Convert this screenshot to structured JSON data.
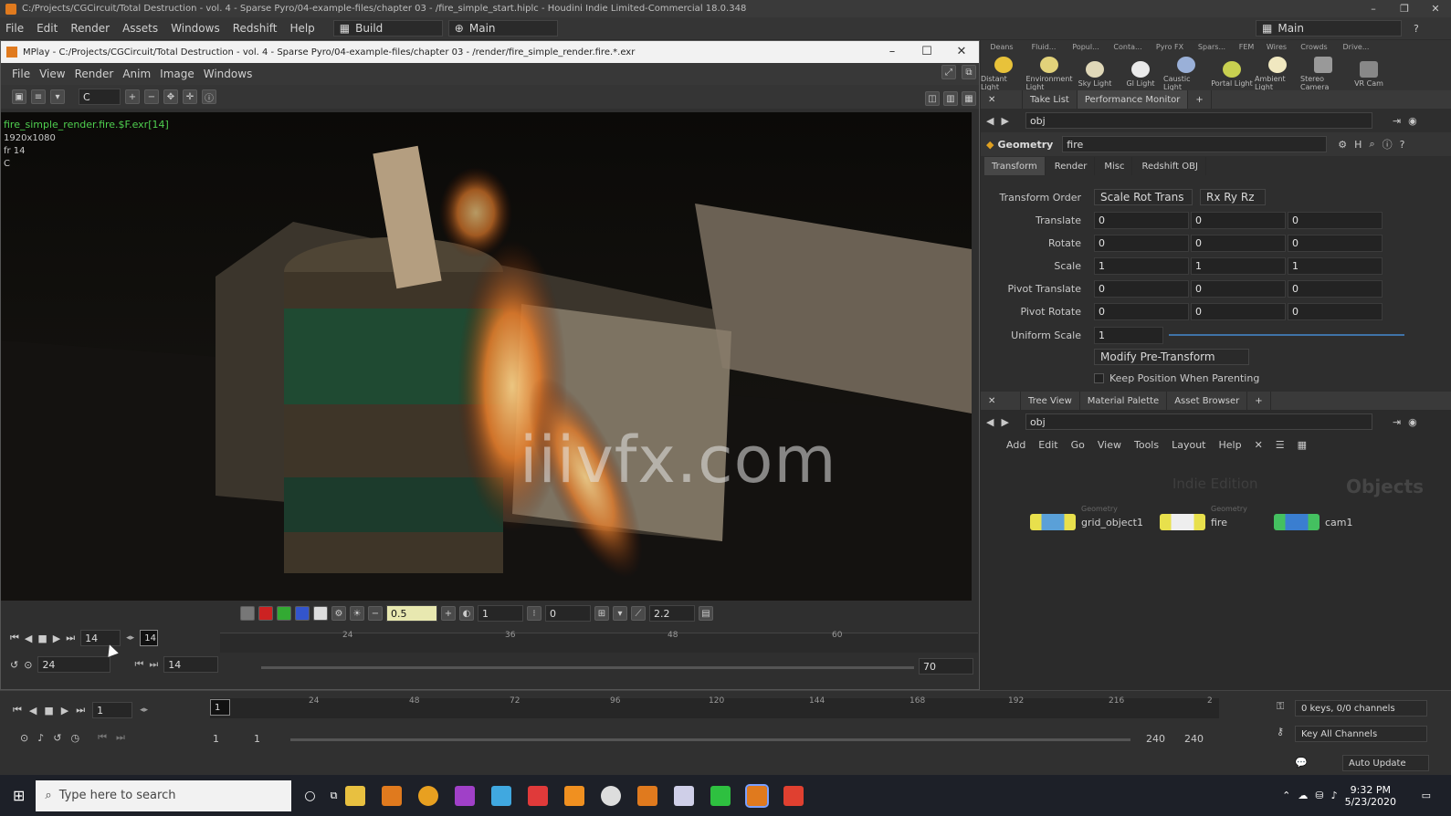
{
  "window": {
    "title": "C:/Projects/CGCircuit/Total Destruction - vol. 4 - Sparse Pyro/04-example-files/chapter 03 - /fire_simple_start.hiplc - Houdini Indie Limited-Commercial 18.0.348"
  },
  "menubar": {
    "items": [
      "File",
      "Edit",
      "Render",
      "Assets",
      "Windows",
      "Redshift",
      "Help"
    ],
    "desktop": "Build",
    "context": "Main",
    "right_desk": "Main"
  },
  "mplay": {
    "title": "MPlay - C:/Projects/CGCircuit/Total Destruction - vol. 4 - Sparse Pyro/04-example-files/chapter 03 - /render/fire_simple_render.fire.*.exr",
    "menu": [
      "File",
      "View",
      "Render",
      "Anim",
      "Image",
      "Windows"
    ],
    "channel": "C",
    "overlay": {
      "filename": "fire_simple_render.fire.$F.exr[14]",
      "res": "1920x1080",
      "frame": "fr 14",
      "channel": "C"
    },
    "watermark": "iiivfx.com",
    "controls": {
      "exposure": "0.5",
      "gamma_in": "1",
      "offset": "0",
      "gamma": "2.2"
    },
    "playbar": {
      "frame": "14",
      "frame_tag": "14",
      "fps": "24",
      "range_start": "14",
      "range_end": "70",
      "ticks": [
        "24",
        "36",
        "48",
        "60"
      ]
    }
  },
  "shelf": {
    "tabs": [
      "Deans",
      "Fluid...",
      "Popul...",
      "Conta...",
      "Pyro FX",
      "Spars...",
      "FEM",
      "Wires",
      "Crowds",
      "Drive..."
    ],
    "tools": [
      "Distant Light",
      "Environment Light",
      "Sky Light",
      "GI Light",
      "Caustic Light",
      "Portal Light",
      "Ambient Light",
      "Stereo Camera",
      "VR Cam"
    ]
  },
  "params": {
    "tabs_top": [
      "Take List",
      "Performance Monitor"
    ],
    "path": "obj",
    "node_type": "Geometry",
    "node_name": "fire",
    "tabs": [
      "Transform",
      "Render",
      "Misc",
      "Redshift OBJ"
    ],
    "transform_order_label": "Transform Order",
    "transform_order": "Scale Rot Trans",
    "rot_order": "Rx Ry Rz",
    "rows": [
      {
        "label": "Translate",
        "values": [
          "0",
          "0",
          "0"
        ]
      },
      {
        "label": "Rotate",
        "values": [
          "0",
          "0",
          "0"
        ]
      },
      {
        "label": "Scale",
        "values": [
          "1",
          "1",
          "1"
        ]
      },
      {
        "label": "Pivot Translate",
        "values": [
          "0",
          "0",
          "0"
        ]
      },
      {
        "label": "Pivot Rotate",
        "values": [
          "0",
          "0",
          "0"
        ]
      }
    ],
    "uniform_scale_label": "Uniform Scale",
    "uniform_scale": "1",
    "modify_pre": "Modify Pre-Transform",
    "keep_position": "Keep Position When Parenting"
  },
  "network": {
    "tabs": [
      "Tree View",
      "Material Palette",
      "Asset Browser"
    ],
    "path": "obj",
    "menu": [
      "Add",
      "Edit",
      "Go",
      "View",
      "Tools",
      "Layout",
      "Help"
    ],
    "bg_label": "Indie Edition",
    "context_label": "Objects",
    "nodes": [
      {
        "label": "grid_object1",
        "type": "Geometry"
      },
      {
        "label": "fire",
        "type": "Geometry"
      },
      {
        "label": "cam1",
        "type": ""
      }
    ]
  },
  "timeline": {
    "frame": "1",
    "frame_tag": "1",
    "ticks": [
      "24",
      "48",
      "72",
      "96",
      "120",
      "144",
      "168",
      "192",
      "216",
      "2"
    ],
    "start": "1",
    "start2": "1",
    "end": "240",
    "end2": "240",
    "keys": "0 keys, 0/0 channels",
    "key_all": "Key All Channels",
    "auto_update": "Auto Update"
  },
  "taskbar": {
    "search": "Type here to search",
    "time": "9:32 PM",
    "date": "5/23/2020"
  }
}
